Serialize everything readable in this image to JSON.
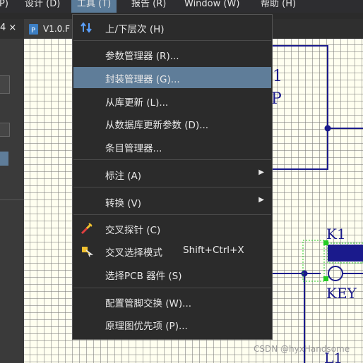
{
  "menubar": {
    "items": [
      {
        "label": "P)"
      },
      {
        "label": "设计 (D)"
      },
      {
        "label": "工具 (T)"
      },
      {
        "label": "报告 (R)"
      },
      {
        "label": "Window (W)"
      },
      {
        "label": "帮助 (H)"
      }
    ]
  },
  "left_panel": {
    "close_label": "4 ×"
  },
  "document_tab": {
    "label": "V1.0.F"
  },
  "tools_menu": {
    "items": [
      {
        "label": "上/下层次 (H)",
        "icon": "hierarchy-arrows-icon"
      },
      {
        "label": "参数管理器 (R)..."
      },
      {
        "label": "封装管理器 (G)...",
        "highlighted": true
      },
      {
        "label": "从库更新 (L)..."
      },
      {
        "label": "从数据库更新参数 (D)..."
      },
      {
        "label": "条目管理器..."
      },
      {
        "label": "标注 (A)",
        "submenu": true
      },
      {
        "label": "转换 (V)",
        "submenu": true
      },
      {
        "label": "交叉探针 (C)",
        "icon": "cross-probe-icon"
      },
      {
        "label": "交叉选择模式",
        "shortcut": "Shift+Ctrl+X",
        "icon": "cross-select-icon"
      },
      {
        "label": "选择PCB 器件 (S)"
      },
      {
        "label": "配置管脚交换 (W)..."
      },
      {
        "label": "原理图优先项 (P)..."
      }
    ],
    "submenu_arrow": "▶"
  },
  "schematic": {
    "ref_top_1": "1",
    "ref_top_2": "P",
    "k1_label": "K1",
    "key_label": "KEY",
    "l1_label": "L1",
    "wire_color": "#1a1a8c"
  },
  "watermark": "CSDN @hyxHandsome"
}
